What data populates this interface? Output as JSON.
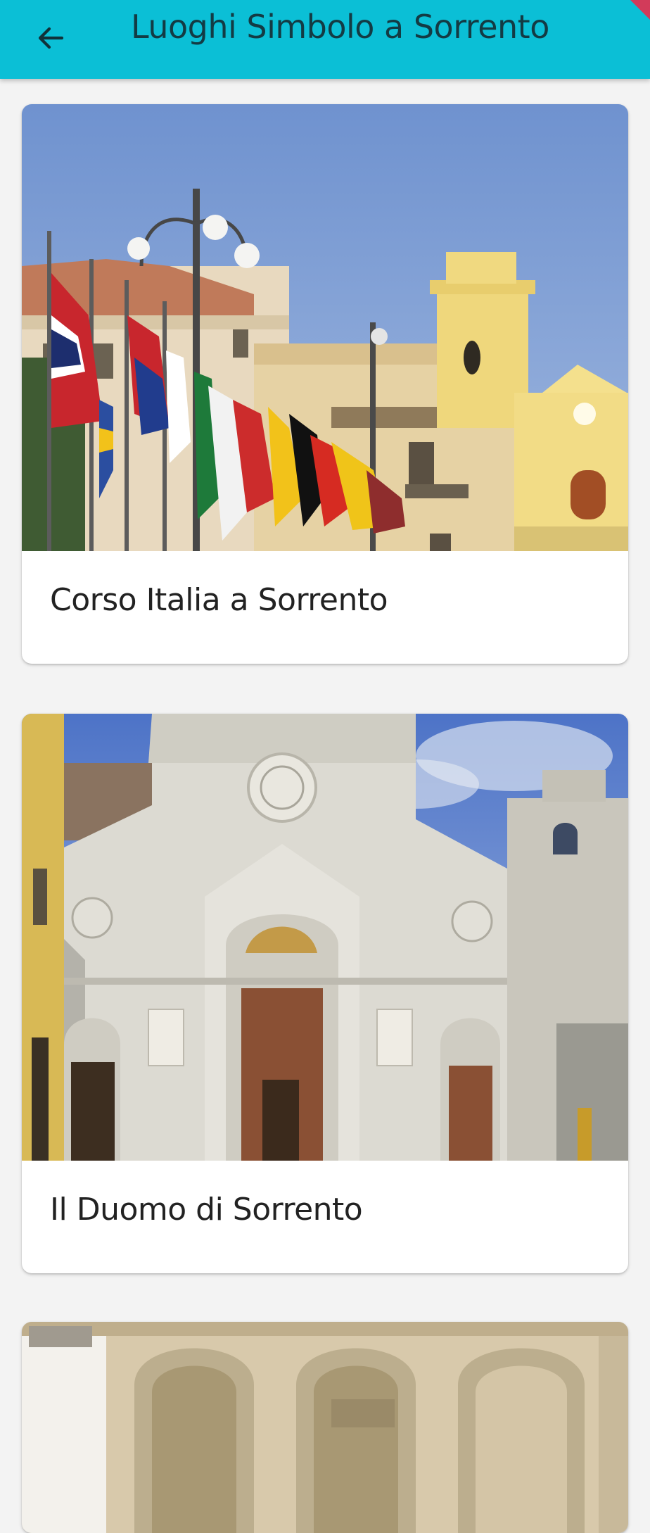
{
  "header": {
    "title": "Luoghi Simbolo a Sorrento",
    "back_icon": "arrow-left-icon",
    "background_color": "#0bbfd6"
  },
  "cards": [
    {
      "label": "Corso Italia a Sorrento",
      "image": "photo-corso-italia-flags-and-yellow-church"
    },
    {
      "label": "Il Duomo di Sorrento",
      "image": "photo-duomo-white-cathedral-facade"
    },
    {
      "label": "",
      "image": "photo-arched-building-partial"
    }
  ]
}
